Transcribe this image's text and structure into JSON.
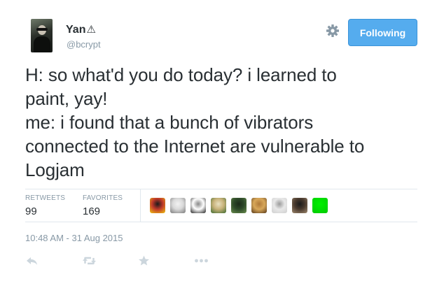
{
  "user": {
    "display_name": "Yan",
    "name_glyph": "⚠",
    "screen_name": "@bcrypt"
  },
  "header": {
    "follow_button_label": "Following"
  },
  "tweet": {
    "lines": [
      "H: so what'd you do today? i learned to",
      "paint, yay!",
      "me: i found that a bunch of vibrators",
      "connected to the Internet are vulnerable to",
      "Logjam"
    ]
  },
  "stats": {
    "retweets_label": "RETWEETS",
    "retweets_value": "99",
    "favorites_label": "FAVORITES",
    "favorites_value": "169"
  },
  "favoriters": [
    {
      "name": "favoriter-avatar-1",
      "colors": [
        "#c0392b",
        "#f1c40f",
        "#1a1a1a"
      ]
    },
    {
      "name": "favoriter-avatar-2",
      "colors": [
        "#d9d9d9",
        "#7a7a7a",
        "#f2f2f2"
      ]
    },
    {
      "name": "favoriter-avatar-3",
      "colors": [
        "#ffffff",
        "#222222",
        "#888888"
      ]
    },
    {
      "name": "favoriter-avatar-4",
      "colors": [
        "#c8b27a",
        "#3e6b2f",
        "#e8e0c0"
      ]
    },
    {
      "name": "favoriter-avatar-5",
      "colors": [
        "#2e4a2a",
        "#6b8f4e",
        "#1b2a1a"
      ]
    },
    {
      "name": "favoriter-avatar-6",
      "colors": [
        "#d8a85a",
        "#5a3a1a",
        "#b07a3a"
      ]
    },
    {
      "name": "favoriter-avatar-7",
      "colors": [
        "#e8e8e8",
        "#cfcfcf",
        "#9a9a9a"
      ]
    },
    {
      "name": "favoriter-avatar-8",
      "colors": [
        "#4a3a2e",
        "#a08a70",
        "#1a1a1a"
      ]
    },
    {
      "name": "favoriter-avatar-9",
      "colors": [
        "#00e000",
        "#00c800",
        "#00f000"
      ]
    }
  ],
  "timestamp": "10:48 AM - 31 Aug 2015",
  "actions": {
    "reply_icon": "reply-icon",
    "retweet_icon": "retweet-icon",
    "favorite_icon": "star-icon",
    "more_icon": "more-icon"
  },
  "colors": {
    "accent": "#55acee",
    "muted": "#8899a6",
    "text": "#292f33",
    "action_icon": "#ccd6dd"
  }
}
